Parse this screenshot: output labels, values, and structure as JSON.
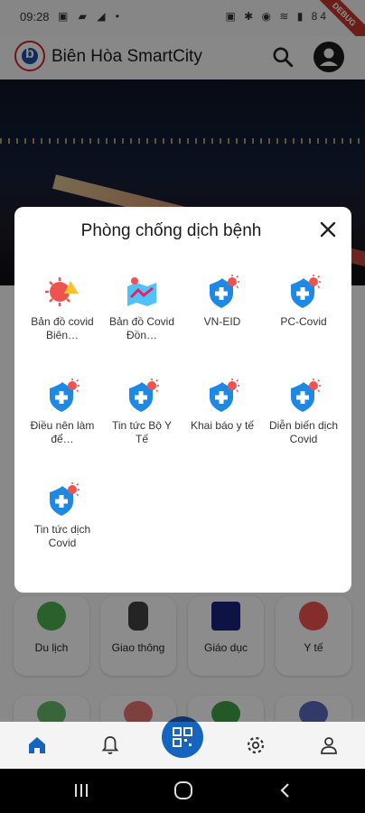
{
  "status_bar": {
    "time": "09:28",
    "left_icons": "▣ ▰ ◢ •",
    "right_icons": "▣ ✱ ◉ ≋ ▮ 84",
    "debug_label": "DEBUG"
  },
  "app_bar": {
    "title": "Biên Hòa SmartCity"
  },
  "dialog": {
    "title": "Phòng chống dịch bệnh",
    "items": [
      {
        "label": "Bản đồ covid Biên…",
        "icon": "covid-virus-icon"
      },
      {
        "label": "Bản đồ Covid Đồn…",
        "icon": "covid-map-icon"
      },
      {
        "label": "VN-EID",
        "icon": "shield-virus-icon"
      },
      {
        "label": "PC-Covid",
        "icon": "shield-virus-icon"
      },
      {
        "label": "Điều nên làm để…",
        "icon": "shield-virus-icon"
      },
      {
        "label": "Tin tức Bộ Y Tế",
        "icon": "shield-virus-icon"
      },
      {
        "label": "Khai báo y tế",
        "icon": "shield-virus-icon"
      },
      {
        "label": "Diễn biến dịch Covid",
        "icon": "shield-virus-icon"
      },
      {
        "label": "Tin tức dịch Covid",
        "icon": "shield-virus-icon"
      }
    ]
  },
  "categories": [
    {
      "label": "Du lịch",
      "icon": "globe-icon",
      "color": "#2e7d32"
    },
    {
      "label": "Giao thông",
      "icon": "traffic-light-icon",
      "color": "#424242"
    },
    {
      "label": "Giáo dục",
      "icon": "graduation-cap-icon",
      "color": "#1a237e"
    },
    {
      "label": "Y tế",
      "icon": "heart-hand-icon",
      "color": "#e53935"
    }
  ],
  "colors": {
    "accent": "#1565c0",
    "shield": "#1e88e5",
    "virus": "#e53935",
    "overlay": "rgba(0,0,0,0.45)"
  }
}
